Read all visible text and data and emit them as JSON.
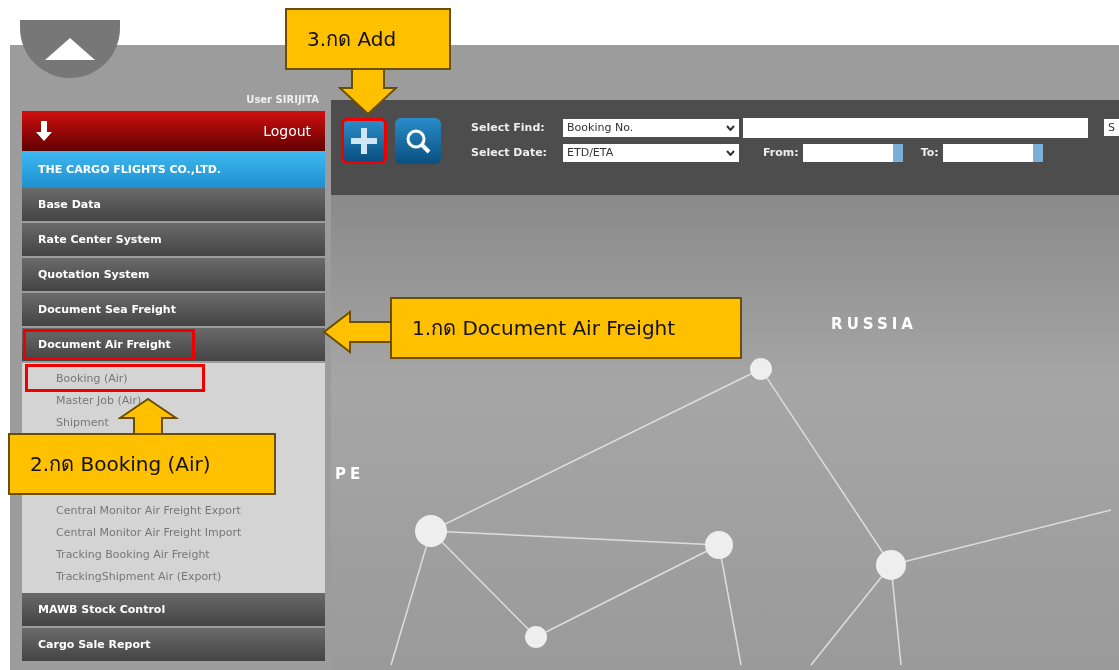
{
  "header": {
    "user": "User SIRIJITA"
  },
  "sidebar": {
    "logout": "Logout",
    "company": "THE CARGO FLIGHTS CO.,LTD.",
    "items": [
      {
        "label": "Base Data",
        "highlighted": false
      },
      {
        "label": "Rate Center System",
        "highlighted": false
      },
      {
        "label": "Quotation System",
        "highlighted": false
      },
      {
        "label": "Document Sea Freight",
        "highlighted": false
      },
      {
        "label": "Document Air Freight",
        "highlighted": true,
        "children": [
          {
            "label": "Booking (Air)",
            "highlighted": true
          },
          {
            "label": "Master Job (Air)",
            "highlighted": false
          },
          {
            "label": "Shipment",
            "highlighted": false
          },
          {
            "label": "Central Monitor Air Freight Export",
            "highlighted": false
          },
          {
            "label": "Central Monitor Air Freight Import",
            "highlighted": false
          },
          {
            "label": "Tracking Booking Air Freight",
            "highlighted": false
          },
          {
            "label": "TrackingShipment Air (Export)",
            "highlighted": false
          }
        ]
      },
      {
        "label": "MAWB Stock Control",
        "highlighted": false
      },
      {
        "label": "Cargo Sale Report",
        "highlighted": false
      }
    ]
  },
  "toolbar": {
    "add_highlighted": true,
    "find_label": "Select Find:",
    "find_value": "Booking No.",
    "cut_text": "S",
    "date_label": "Select Date:",
    "date_value": "ETD/ETA",
    "from_label": "From:",
    "to_label": "To:"
  },
  "map": {
    "labels": [
      "RUSSIA",
      "PE"
    ]
  },
  "callouts": [
    {
      "text": "3.กด Add"
    },
    {
      "text": "1.กด Document Air Freight"
    },
    {
      "text": "2.กด Booking (Air)"
    }
  ]
}
